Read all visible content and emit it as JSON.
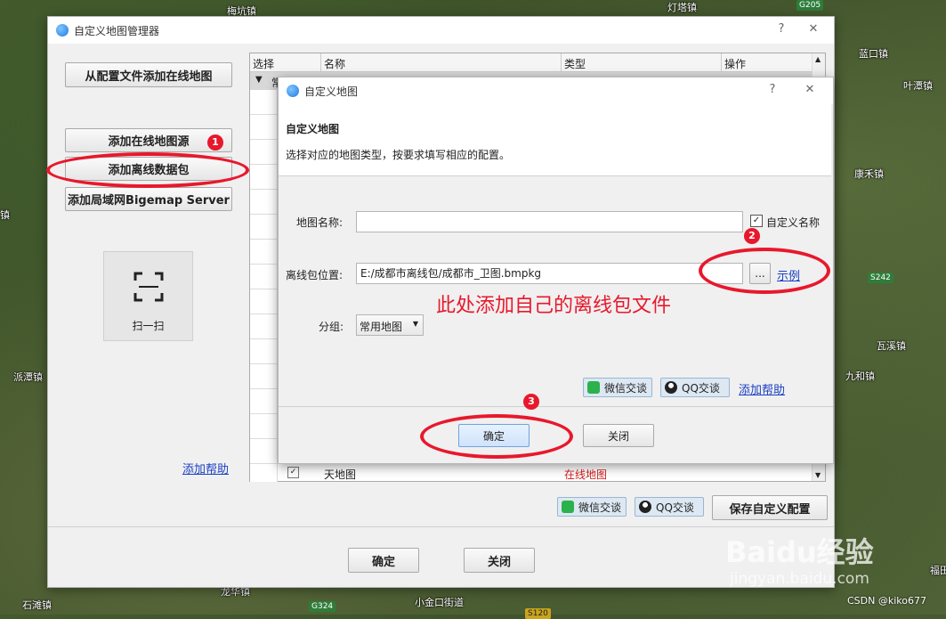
{
  "map": {
    "labels": [
      "梅坑镇",
      "灯塔镇",
      "蓝口镇",
      "叶潭镇",
      "康禾镇",
      "瓦溪镇",
      "九和镇",
      "派潭镇",
      "石滩镇",
      "龙华镇",
      "小金口街道",
      "福田",
      "镇"
    ],
    "roads": [
      "G205",
      "S242",
      "G324",
      "S120"
    ]
  },
  "main_window": {
    "title": "自定义地图管理器",
    "help_icon": "?",
    "close_icon": "✕",
    "btn_add_from_config": "从配置文件添加在线地图",
    "btn_add_online": "添加在线地图源",
    "btn_add_offline": "添加离线数据包",
    "btn_add_lan": "添加局域网Bigemap Server",
    "scan_label": "扫一扫",
    "add_help": "添加帮助",
    "table_headers": [
      "选择",
      "名称",
      "类型",
      "操作"
    ],
    "group_row": "常",
    "bottom_row_name": "天地图",
    "bottom_row_type": "在线地图",
    "wechat": "微信交谈",
    "qq": "QQ交谈",
    "save_config": "保存自定义配置",
    "ok": "确定",
    "close": "关闭"
  },
  "dialog": {
    "title": "自定义地图",
    "help_icon": "?",
    "close_icon": "✕",
    "heading": "自定义地图",
    "description": "选择对应的地图类型，按要求填写相应的配置。",
    "map_name_label": "地图名称:",
    "map_name_value": "",
    "custom_name_label": "自定义名称",
    "custom_name_checked": true,
    "offline_path_label": "离线包位置:",
    "offline_path_value": "E:/成都市离线包/成都市_卫图.bmpkg",
    "browse": "...",
    "example": "示例",
    "group_label": "分组:",
    "group_value": "常用地图",
    "wechat": "微信交谈",
    "qq": "QQ交谈",
    "add_help": "添加帮助",
    "ok": "确定",
    "close": "关闭"
  },
  "annotations": {
    "red_text": "此处添加自己的离线包文件",
    "num1": "1",
    "num2": "2",
    "num3": "3",
    "color": "#e8182c"
  },
  "watermark": {
    "baidu": "Baidu经验",
    "site": "jingyan.baidu.com",
    "csdn": "CSDN @kiko677"
  }
}
